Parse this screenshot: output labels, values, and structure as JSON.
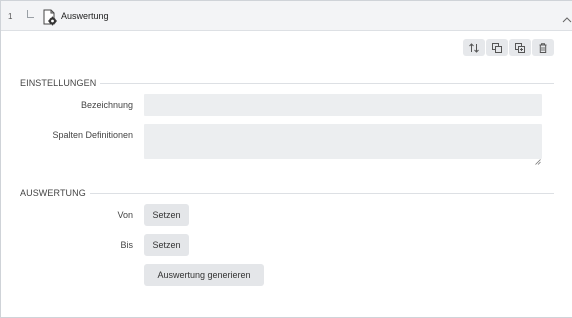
{
  "header": {
    "row_number": "1",
    "title": "Auswertung"
  },
  "toolbar": {
    "icons": [
      "sort-icon",
      "copy-icon",
      "paste-icon",
      "delete-icon"
    ]
  },
  "settings": {
    "section_title": "EINSTELLUNGEN",
    "name_label": "Bezeichnung",
    "name_value": "",
    "columns_label": "Spalten Definitionen",
    "columns_value": ""
  },
  "evaluation": {
    "section_title": "AUSWERTUNG",
    "from_label": "Von",
    "from_button": "Setzen",
    "to_label": "Bis",
    "to_button": "Setzen",
    "generate_button": "Auswertung generieren"
  }
}
